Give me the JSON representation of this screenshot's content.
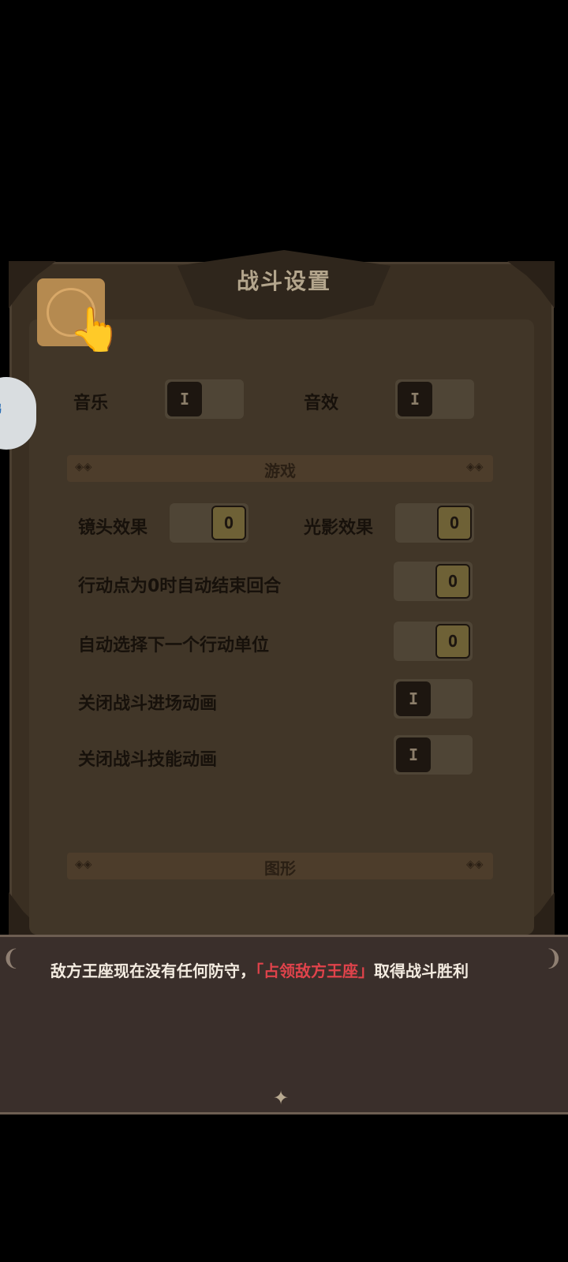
{
  "panel": {
    "title": "战斗设置",
    "audio": {
      "music_label": "音乐",
      "music_state": "I",
      "sfx_label": "音效",
      "sfx_state": "I"
    },
    "game_section": "游戏",
    "game_settings": [
      {
        "label": "镜头效果",
        "state": "O"
      },
      {
        "label": "光影效果",
        "state": "O"
      },
      {
        "label": "行动点为0时自动结束回合",
        "state": "O"
      },
      {
        "label": "自动选择下一个行动单位",
        "state": "O"
      },
      {
        "label": "关闭战斗进场动画",
        "state": "I"
      },
      {
        "label": "关闭战斗技能动画",
        "state": "I"
      }
    ],
    "graphics_section": "图形"
  },
  "side_badge": {
    "text": "鹏"
  },
  "dialog": {
    "text_before": "敌方王座现在没有任何防守，",
    "highlight": "「占领敌方王座」",
    "text_after": "取得战斗胜利"
  },
  "icons": {
    "close": "close-icon",
    "hand": "tap-hand-icon",
    "next": "next-arrow-icon"
  }
}
